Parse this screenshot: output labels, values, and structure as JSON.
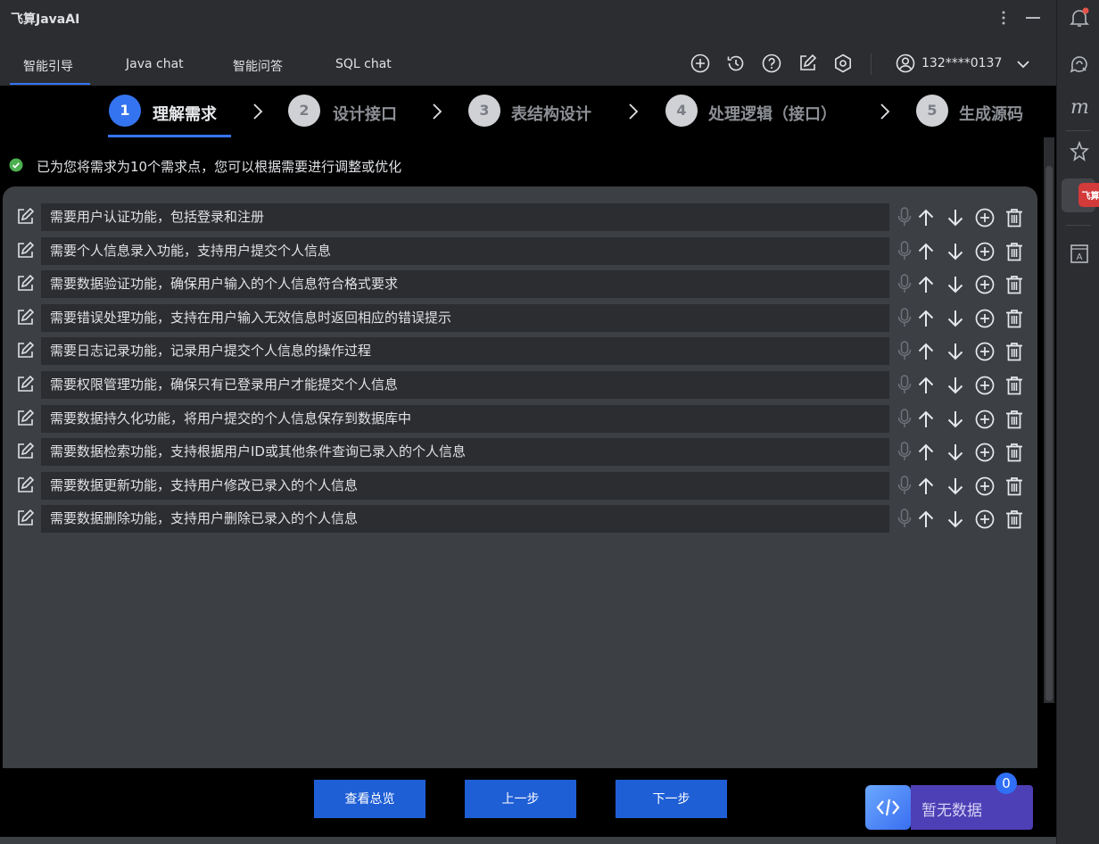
{
  "app": {
    "title": "飞算JavaAI"
  },
  "tabs": [
    {
      "label": "智能引导",
      "active": true
    },
    {
      "label": "Java chat",
      "active": false
    },
    {
      "label": "智能问答",
      "active": false
    },
    {
      "label": "SQL chat",
      "active": false
    }
  ],
  "toolbar": {
    "icons": [
      "new-chat-icon",
      "history-icon",
      "help-icon",
      "edit-icon",
      "settings-icon"
    ],
    "user_label": "132****0137"
  },
  "steps": [
    {
      "number": "1",
      "label": "理解需求",
      "active": true
    },
    {
      "number": "2",
      "label": "设计接口",
      "active": false
    },
    {
      "number": "3",
      "label": "表结构设计",
      "active": false
    },
    {
      "number": "4",
      "label": "处理逻辑（接口）",
      "active": false
    },
    {
      "number": "5",
      "label": "生成源码",
      "active": false
    }
  ],
  "notice": {
    "text": "已为您将需求为10个需求点，您可以根据需要进行调整或优化",
    "icon": "success-check-icon"
  },
  "requirements": [
    "需要用户认证功能，包括登录和注册",
    "需要个人信息录入功能，支持用户提交个人信息",
    "需要数据验证功能，确保用户输入的个人信息符合格式要求",
    "需要错误处理功能，支持在用户输入无效信息时返回相应的错误提示",
    "需要日志记录功能，记录用户提交个人信息的操作过程",
    "需要权限管理功能，确保只有已登录用户才能提交个人信息",
    "需要数据持久化功能，将用户提交的个人信息保存到数据库中",
    "需要数据检索功能，支持根据用户ID或其他条件查询已录入的个人信息",
    "需要数据更新功能，支持用户修改已录入的个人信息",
    "需要数据删除功能，支持用户删除已录入的个人信息"
  ],
  "buttons": {
    "overview": "查看总览",
    "prev": "上一步",
    "next": "下一步"
  },
  "code_widget": {
    "label": "暂无数据",
    "badge": "0",
    "icon": "code-brackets-icon"
  },
  "right_sidebar": {
    "icons": [
      "notifications-icon",
      "ai-chat-icon",
      "m-plugin-icon",
      "sparkle-icon",
      "feisuan-logo-icon",
      "text-a-icon"
    ],
    "active_logo_text": "飞算"
  },
  "colors": {
    "accent": "#3574f0",
    "button": "#1f5fd6",
    "success": "#4caf50",
    "badge": "#2f6ff5"
  }
}
